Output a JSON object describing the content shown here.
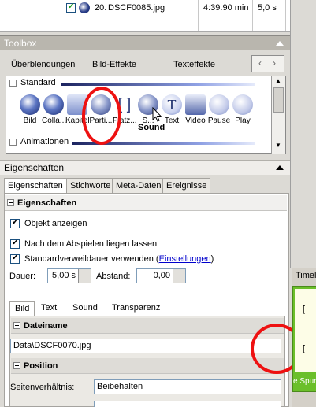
{
  "file_list": {
    "row": {
      "number": "20.",
      "name": "DSCF0085.jpg",
      "duration": "4:39.90 min",
      "length": "5,0 s"
    }
  },
  "toolbox": {
    "title": "Toolbox",
    "tabs": [
      "Überblendungen",
      "Bild-Effekte",
      "Texteffekte"
    ],
    "groups": {
      "standard": "Standard",
      "animationen": "Animationen"
    },
    "tools": [
      {
        "label": "Bild",
        "icon": "picture-icon"
      },
      {
        "label": "Colla...",
        "icon": "collage-icon"
      },
      {
        "label": "Kapitel",
        "icon": "chapter-icon"
      },
      {
        "label": "Parti...",
        "icon": "particle-icon"
      },
      {
        "label": "Platz...",
        "icon": "placeholder-icon"
      },
      {
        "label": "S...",
        "icon": "sound-icon"
      },
      {
        "label": "Text",
        "icon": "text-icon"
      },
      {
        "label": "Video",
        "icon": "video-icon"
      },
      {
        "label": "Pause",
        "icon": "pause-icon"
      },
      {
        "label": "Play",
        "icon": "play-icon"
      }
    ],
    "tooltip": "Sound"
  },
  "properties": {
    "title": "Eigenschaften",
    "tabs": [
      "Eigenschaften",
      "Stichworte",
      "Meta-Daten",
      "Ereignisse"
    ],
    "section_title": "Eigenschaften",
    "show_object": "Objekt anzeigen",
    "keep_after_play": "Nach dem Abspielen liegen lassen",
    "default_duration_prefix": "Standardverweildauer verwenden (",
    "default_duration_link": "Einstellungen",
    "default_duration_suffix": ")",
    "duration_label": "Dauer:",
    "duration_value": "5,00 s",
    "gap_label": "Abstand:",
    "gap_value": "0,00",
    "subtabs": [
      "Bild",
      "Text",
      "Sound",
      "Transparenz"
    ],
    "file_section": "Dateiname",
    "file_value": "Data\\DSCF0070.jpg",
    "position_section": "Position",
    "aspect_label": "Seitenverhältnis:",
    "aspect_value": "Beibehalten"
  },
  "timeline": {
    "label": "Timeli",
    "partial_text": "e Spur",
    "bracket_top": "[",
    "bracket_bottom": "["
  }
}
